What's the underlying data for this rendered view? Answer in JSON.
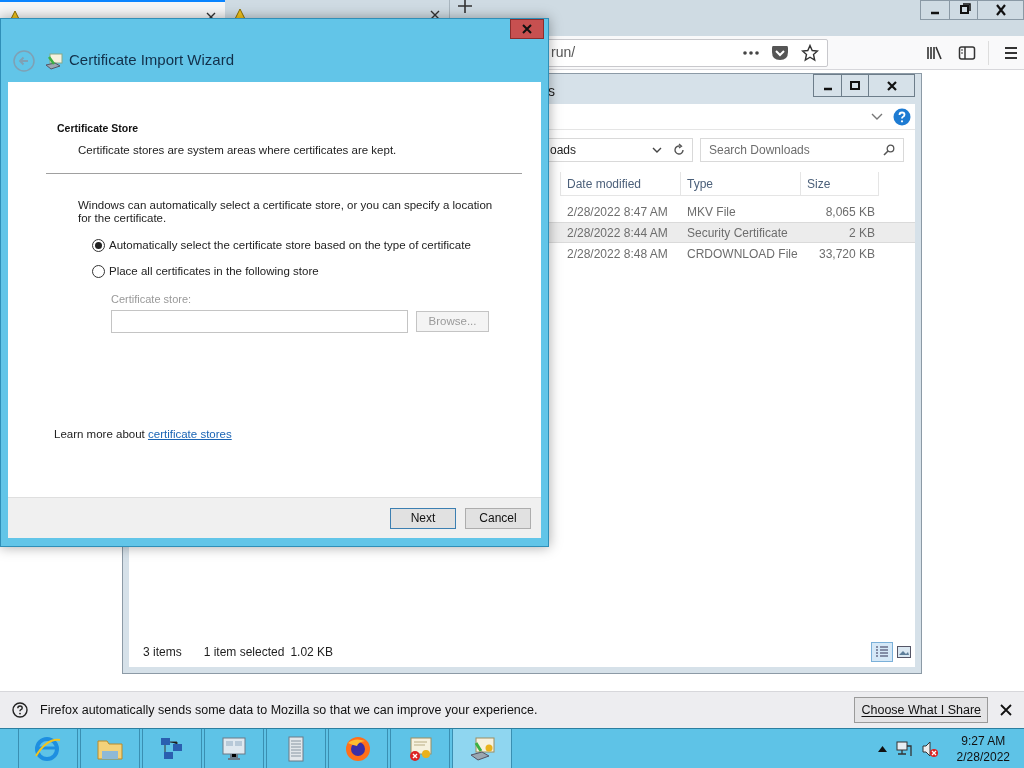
{
  "browser": {
    "tabs": [
      {
        "selected": true
      },
      {
        "selected": false
      }
    ],
    "url_tail": "run/"
  },
  "explorer": {
    "title_tail": "s",
    "location_tail": "oads",
    "search_placeholder": "Search Downloads",
    "columns": [
      "Date modified",
      "Type",
      "Size"
    ],
    "rows": [
      {
        "date_modified": "2/28/2022 8:47 AM",
        "type": "MKV File",
        "size": "8,065 KB",
        "selected": false
      },
      {
        "date_modified": "2/28/2022 8:44 AM",
        "type": "Security Certificate",
        "size": "2 KB",
        "selected": true
      },
      {
        "date_modified": "2/28/2022 8:48 AM",
        "type": "CRDOWNLOAD File",
        "size": "33,720 KB",
        "selected": false
      }
    ],
    "status": {
      "item_count": "3 items",
      "selection": "1 item selected",
      "selection_size": "1.02 KB"
    }
  },
  "dialog": {
    "title": "Certificate Import Wizard",
    "heading": "Certificate Store",
    "subheading": "Certificate stores are system areas where certificates are kept.",
    "intro": "Windows can automatically select a certificate store, or you can specify a location for the certificate.",
    "options": [
      {
        "label": "Automatically select the certificate store based on the type of certificate",
        "selected": true
      },
      {
        "label": "Place all certificates in the following store",
        "selected": false
      }
    ],
    "store_field": {
      "label": "Certificate store:",
      "disabled": true
    },
    "browse_button": {
      "label": "Browse...",
      "disabled": true
    },
    "learn_more": {
      "text": "Learn more about ",
      "link": "certificate stores"
    },
    "buttons": [
      "Next",
      "Cancel"
    ]
  },
  "notification": {
    "message": "Firefox automatically sends some data to Mozilla so that we can improve your experience.",
    "button": "Choose What I Share"
  },
  "taskbar": {
    "apps": [
      {
        "kind": "browser",
        "selected": false
      },
      {
        "kind": "folder",
        "selected": false
      },
      {
        "kind": "network",
        "selected": false
      },
      {
        "kind": "monitor",
        "selected": false
      },
      {
        "kind": "notebook",
        "selected": false
      },
      {
        "kind": "firefox",
        "selected": false
      },
      {
        "kind": "certerror",
        "selected": false
      },
      {
        "kind": "certimport",
        "selected": true
      }
    ],
    "clock": {
      "time": "9:27 AM",
      "date": "2/28/2022"
    }
  }
}
